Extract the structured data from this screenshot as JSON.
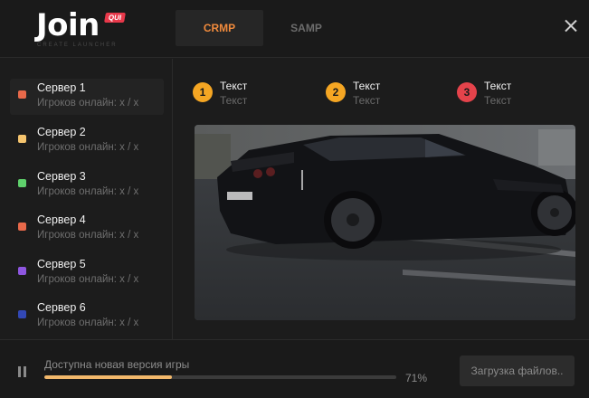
{
  "logo": {
    "text": "Join",
    "badge": "QUI",
    "tagline": "CREATE LAUNCHER"
  },
  "tabs": [
    {
      "label": "CRMP",
      "active": true
    },
    {
      "label": "SAMP",
      "active": false
    }
  ],
  "close_icon": "close-icon",
  "servers": [
    {
      "name": "Сервер 1",
      "online": "Игроков онлайн: x / x",
      "color": "#e8694a",
      "active": true
    },
    {
      "name": "Сервер 2",
      "online": "Игроков онлайн: x / x",
      "color": "#f5c46e",
      "active": false
    },
    {
      "name": "Сервер 3",
      "online": "Игроков онлайн: x / x",
      "color": "#5fd16c",
      "active": false
    },
    {
      "name": "Сервер 4",
      "online": "Игроков онлайн: x / x",
      "color": "#e8694a",
      "active": false
    },
    {
      "name": "Сервер 5",
      "online": "Игроков онлайн: x / x",
      "color": "#8e56e0",
      "active": false
    },
    {
      "name": "Сервер 6",
      "online": "Игроков онлайн: x / x",
      "color": "#3248b5",
      "active": false
    }
  ],
  "steps": [
    {
      "number": "1",
      "title": "Текст",
      "subtitle": "Текст",
      "color": "#f5a623"
    },
    {
      "number": "2",
      "title": "Текст",
      "subtitle": "Текст",
      "color": "#f5a623"
    },
    {
      "number": "3",
      "title": "Текст",
      "subtitle": "Текст",
      "color": "#e5434b"
    }
  ],
  "footer": {
    "update_text": "Доступна новая версия игры",
    "progress_percent": 71,
    "progress_label": "71%",
    "download_button": "Загрузка файлов.."
  }
}
